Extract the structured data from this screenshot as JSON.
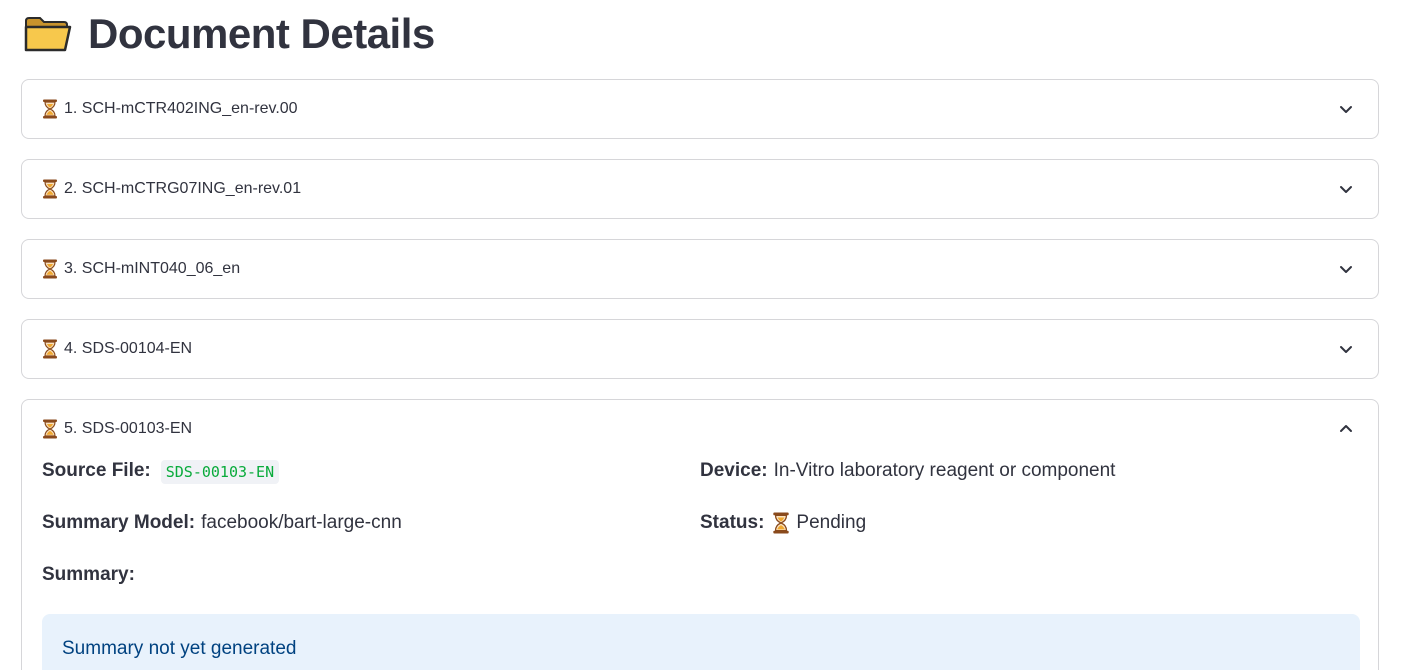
{
  "page": {
    "title": "Document Details",
    "title_icon": "folder-icon"
  },
  "documents": [
    {
      "label": "1. SCH-mCTR402ING_en-rev.00",
      "status_icon": "hourglass-icon",
      "expanded": false
    },
    {
      "label": "2. SCH-mCTRG07ING_en-rev.01",
      "status_icon": "hourglass-icon",
      "expanded": false
    },
    {
      "label": "3. SCH-mINT040_06_en",
      "status_icon": "hourglass-icon",
      "expanded": false
    },
    {
      "label": "4. SDS-00104-EN",
      "status_icon": "hourglass-icon",
      "expanded": false
    },
    {
      "label": "5. SDS-00103-EN",
      "status_icon": "hourglass-icon",
      "expanded": true
    }
  ],
  "detail": {
    "source_file_label": "Source File:",
    "source_file_value": "SDS-00103-EN",
    "device_label": "Device:",
    "device_value": "In-Vitro laboratory reagent or component",
    "summary_model_label": "Summary Model:",
    "summary_model_value": "facebook/bart-large-cnn",
    "status_label": "Status:",
    "status_value": "Pending",
    "summary_label": "Summary:",
    "summary_info": "Summary not yet generated"
  },
  "colors": {
    "text": "#31333f",
    "border": "#d6d6d9",
    "code_text": "#09ab3b",
    "info_bg": "#e8f2fc",
    "info_text": "#004280"
  }
}
